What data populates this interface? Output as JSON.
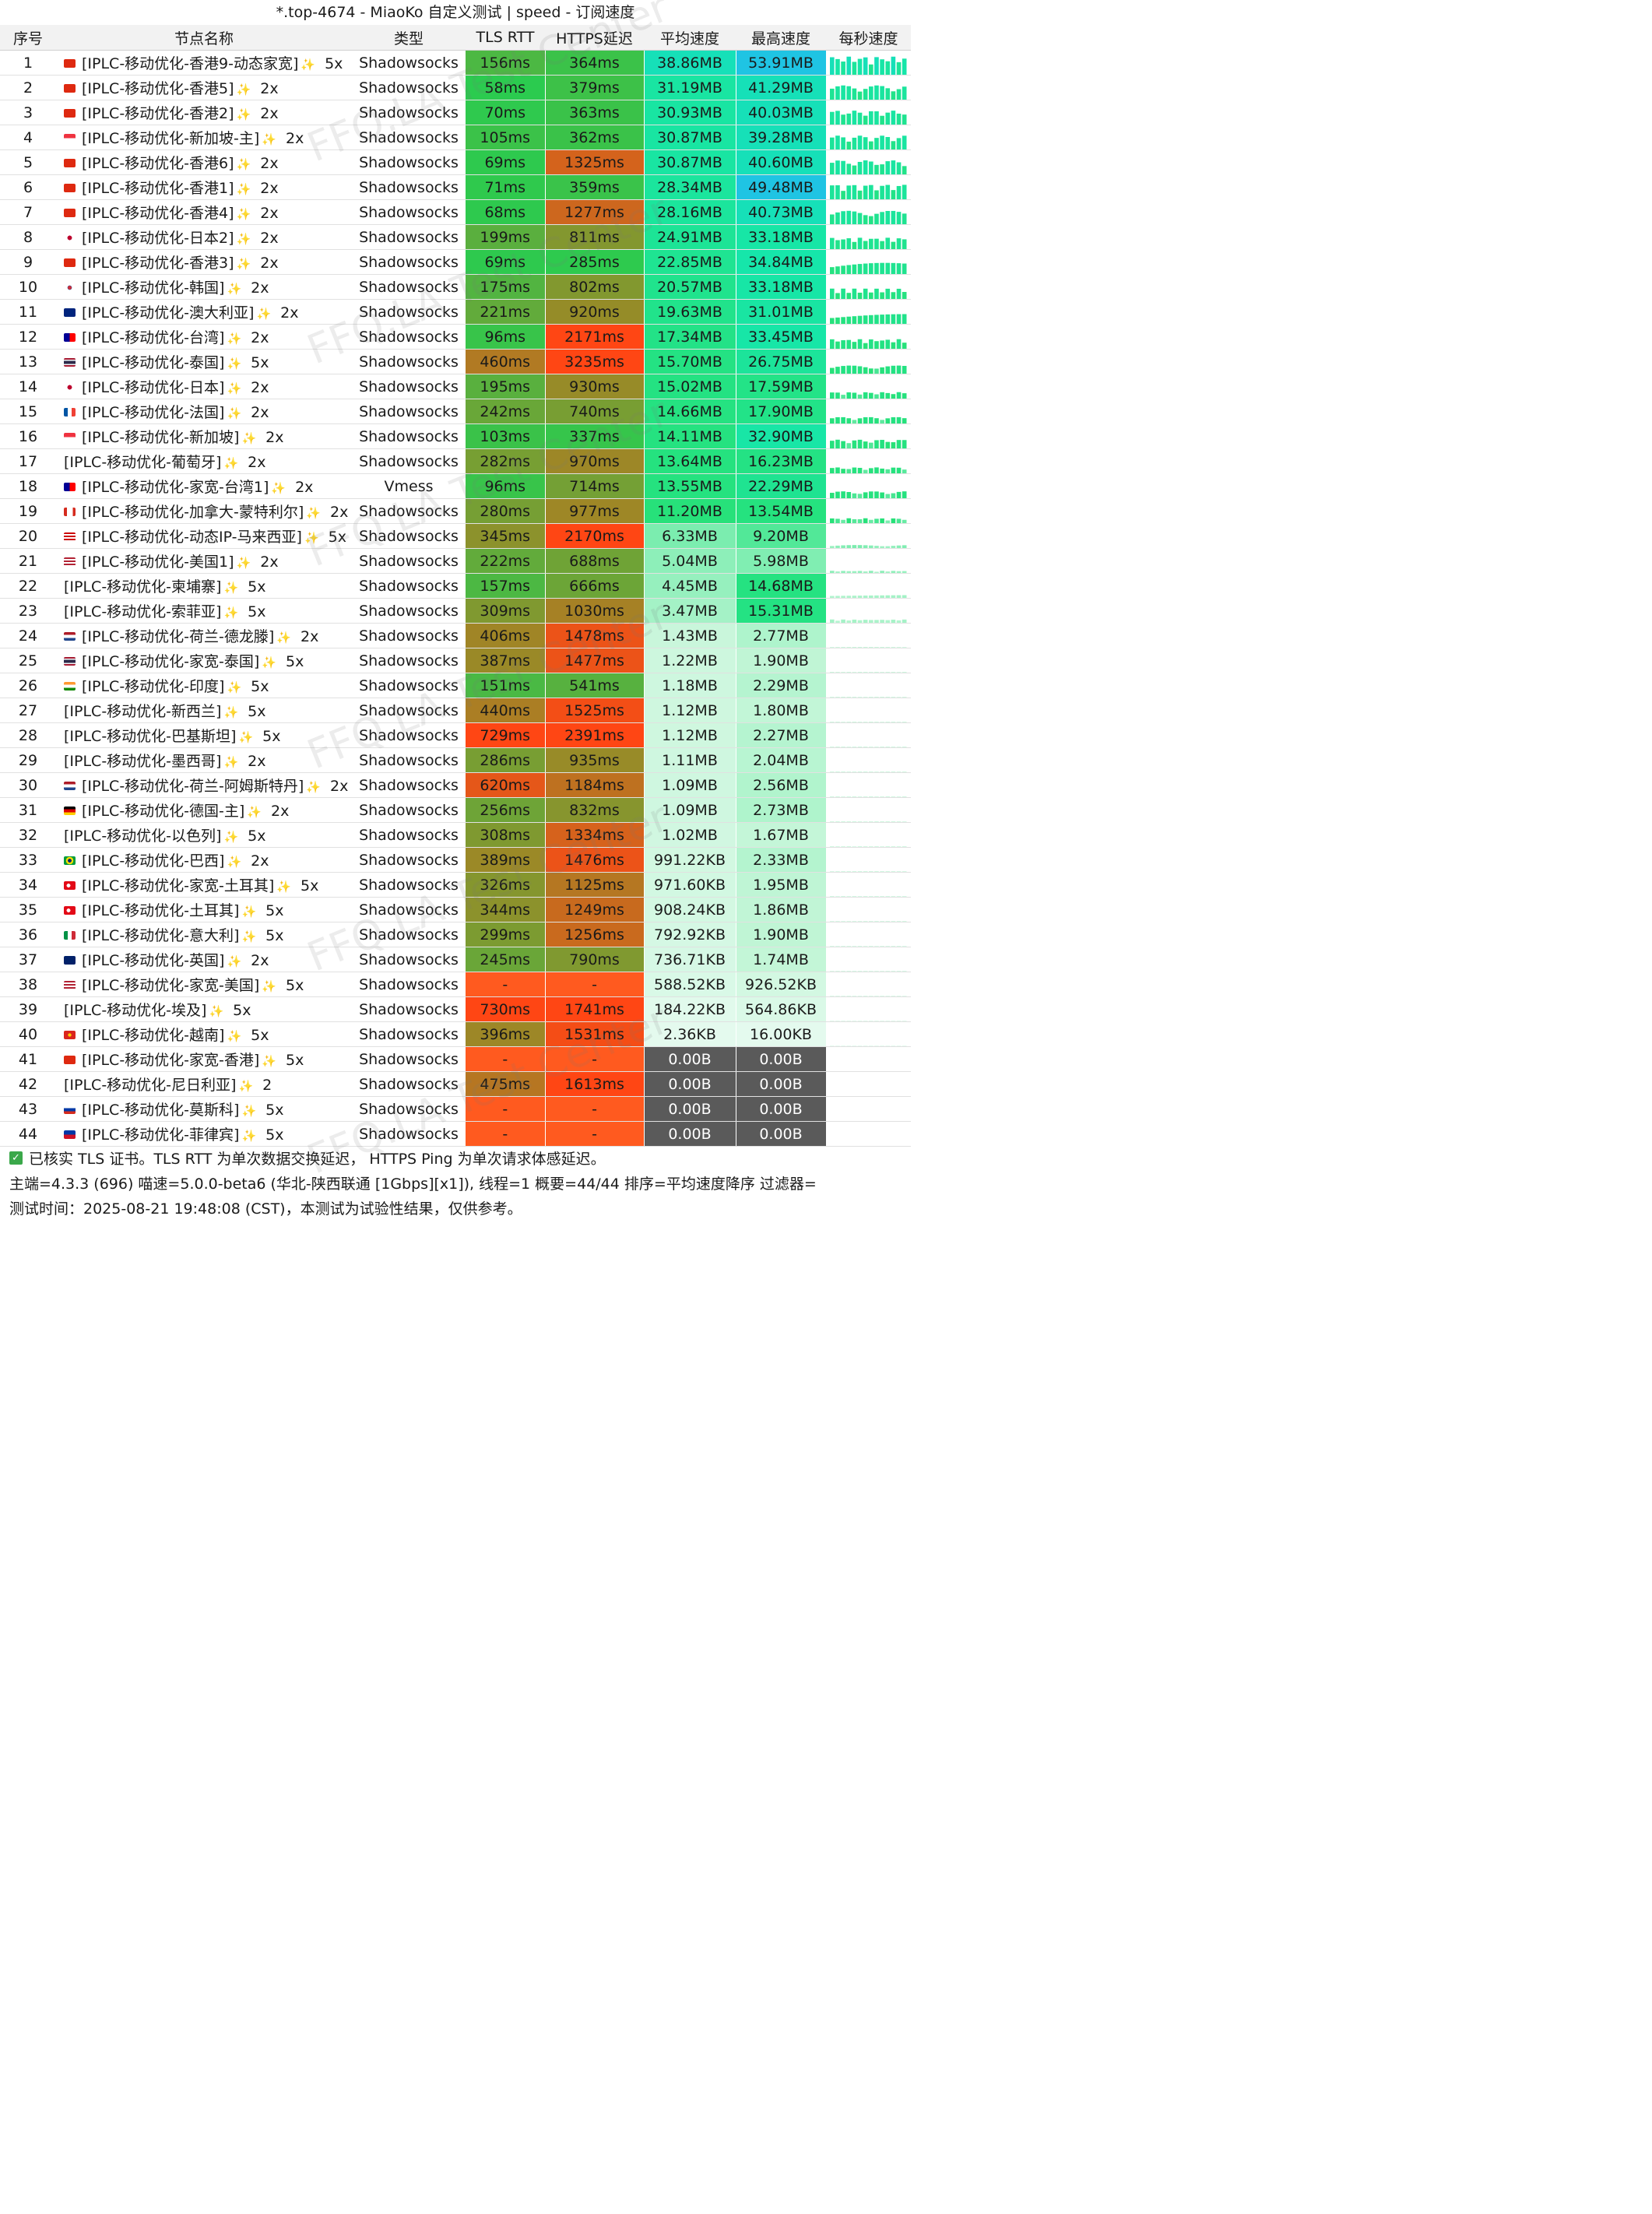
{
  "title": "*.top-4674 - MiaoKo 自定义测试 | speed - 订阅速度",
  "columns": [
    "序号",
    "节点名称",
    "类型",
    "TLS RTT",
    "HTTPS延迟",
    "平均速度",
    "最高速度",
    "每秒速度"
  ],
  "rows": [
    {
      "idx": "1",
      "flag": "hk",
      "name": "[IPLC-移动优化-香港9-动态家宽]",
      "mult": "5x",
      "type": "Shadowsocks",
      "tls": "156ms",
      "https": "364ms",
      "avg": "38.86MB",
      "max": "53.91MB"
    },
    {
      "idx": "2",
      "flag": "hk",
      "name": "[IPLC-移动优化-香港5]",
      "mult": "2x",
      "type": "Shadowsocks",
      "tls": "58ms",
      "https": "379ms",
      "avg": "31.19MB",
      "max": "41.29MB"
    },
    {
      "idx": "3",
      "flag": "hk",
      "name": "[IPLC-移动优化-香港2]",
      "mult": "2x",
      "type": "Shadowsocks",
      "tls": "70ms",
      "https": "363ms",
      "avg": "30.93MB",
      "max": "40.03MB"
    },
    {
      "idx": "4",
      "flag": "sg",
      "name": "[IPLC-移动优化-新加坡-主]",
      "mult": "2x",
      "type": "Shadowsocks",
      "tls": "105ms",
      "https": "362ms",
      "avg": "30.87MB",
      "max": "39.28MB"
    },
    {
      "idx": "5",
      "flag": "hk",
      "name": "[IPLC-移动优化-香港6]",
      "mult": "2x",
      "type": "Shadowsocks",
      "tls": "69ms",
      "https": "1325ms",
      "avg": "30.87MB",
      "max": "40.60MB"
    },
    {
      "idx": "6",
      "flag": "hk",
      "name": "[IPLC-移动优化-香港1]",
      "mult": "2x",
      "type": "Shadowsocks",
      "tls": "71ms",
      "https": "359ms",
      "avg": "28.34MB",
      "max": "49.48MB"
    },
    {
      "idx": "7",
      "flag": "hk",
      "name": "[IPLC-移动优化-香港4]",
      "mult": "2x",
      "type": "Shadowsocks",
      "tls": "68ms",
      "https": "1277ms",
      "avg": "28.16MB",
      "max": "40.73MB"
    },
    {
      "idx": "8",
      "flag": "jp",
      "name": "[IPLC-移动优化-日本2]",
      "mult": "2x",
      "type": "Shadowsocks",
      "tls": "199ms",
      "https": "811ms",
      "avg": "24.91MB",
      "max": "33.18MB"
    },
    {
      "idx": "9",
      "flag": "hk",
      "name": "[IPLC-移动优化-香港3]",
      "mult": "2x",
      "type": "Shadowsocks",
      "tls": "69ms",
      "https": "285ms",
      "avg": "22.85MB",
      "max": "34.84MB"
    },
    {
      "idx": "10",
      "flag": "kr",
      "name": "[IPLC-移动优化-韩国]",
      "mult": "2x",
      "type": "Shadowsocks",
      "tls": "175ms",
      "https": "802ms",
      "avg": "20.57MB",
      "max": "33.18MB"
    },
    {
      "idx": "11",
      "flag": "au",
      "name": "[IPLC-移动优化-澳大利亚]",
      "mult": "2x",
      "type": "Shadowsocks",
      "tls": "221ms",
      "https": "920ms",
      "avg": "19.63MB",
      "max": "31.01MB"
    },
    {
      "idx": "12",
      "flag": "tw",
      "name": "[IPLC-移动优化-台湾]",
      "mult": "2x",
      "type": "Shadowsocks",
      "tls": "96ms",
      "https": "2171ms",
      "avg": "17.34MB",
      "max": "33.45MB"
    },
    {
      "idx": "13",
      "flag": "th",
      "name": "[IPLC-移动优化-泰国]",
      "mult": "5x",
      "type": "Shadowsocks",
      "tls": "460ms",
      "https": "3235ms",
      "avg": "15.70MB",
      "max": "26.75MB"
    },
    {
      "idx": "14",
      "flag": "jp",
      "name": "[IPLC-移动优化-日本]",
      "mult": "2x",
      "type": "Shadowsocks",
      "tls": "195ms",
      "https": "930ms",
      "avg": "15.02MB",
      "max": "17.59MB"
    },
    {
      "idx": "15",
      "flag": "fr",
      "name": "[IPLC-移动优化-法国]",
      "mult": "2x",
      "type": "Shadowsocks",
      "tls": "242ms",
      "https": "740ms",
      "avg": "14.66MB",
      "max": "17.90MB"
    },
    {
      "idx": "16",
      "flag": "sg",
      "name": "[IPLC-移动优化-新加坡]",
      "mult": "2x",
      "type": "Shadowsocks",
      "tls": "103ms",
      "https": "337ms",
      "avg": "14.11MB",
      "max": "32.90MB"
    },
    {
      "idx": "17",
      "flag": "",
      "name": "[IPLC-移动优化-葡萄牙]",
      "mult": "2x",
      "type": "Shadowsocks",
      "tls": "282ms",
      "https": "970ms",
      "avg": "13.64MB",
      "max": "16.23MB"
    },
    {
      "idx": "18",
      "flag": "tw",
      "name": "[IPLC-移动优化-家宽-台湾1]",
      "mult": "2x",
      "type": "Vmess",
      "tls": "96ms",
      "https": "714ms",
      "avg": "13.55MB",
      "max": "22.29MB"
    },
    {
      "idx": "19",
      "flag": "ca",
      "name": "[IPLC-移动优化-加拿大-蒙特利尔]",
      "mult": "2x",
      "type": "Shadowsocks",
      "tls": "280ms",
      "https": "977ms",
      "avg": "11.20MB",
      "max": "13.54MB"
    },
    {
      "idx": "20",
      "flag": "my",
      "name": "[IPLC-移动优化-动态IP-马来西亚]",
      "mult": "5x",
      "type": "Shadowsocks",
      "tls": "345ms",
      "https": "2170ms",
      "avg": "6.33MB",
      "max": "9.20MB"
    },
    {
      "idx": "21",
      "flag": "us",
      "name": "[IPLC-移动优化-美国1]",
      "mult": "2x",
      "type": "Shadowsocks",
      "tls": "222ms",
      "https": "688ms",
      "avg": "5.04MB",
      "max": "5.98MB"
    },
    {
      "idx": "22",
      "flag": "",
      "name": "[IPLC-移动优化-柬埔寨]",
      "mult": "5x",
      "type": "Shadowsocks",
      "tls": "157ms",
      "https": "666ms",
      "avg": "4.45MB",
      "max": "14.68MB"
    },
    {
      "idx": "23",
      "flag": "",
      "name": "[IPLC-移动优化-索菲亚]",
      "mult": "5x",
      "type": "Shadowsocks",
      "tls": "309ms",
      "https": "1030ms",
      "avg": "3.47MB",
      "max": "15.31MB"
    },
    {
      "idx": "24",
      "flag": "nl",
      "name": "[IPLC-移动优化-荷兰-德龙滕]",
      "mult": "2x",
      "type": "Shadowsocks",
      "tls": "406ms",
      "https": "1478ms",
      "avg": "1.43MB",
      "max": "2.77MB"
    },
    {
      "idx": "25",
      "flag": "th",
      "name": "[IPLC-移动优化-家宽-泰国]",
      "mult": "5x",
      "type": "Shadowsocks",
      "tls": "387ms",
      "https": "1477ms",
      "avg": "1.22MB",
      "max": "1.90MB"
    },
    {
      "idx": "26",
      "flag": "in",
      "name": "[IPLC-移动优化-印度]",
      "mult": "5x",
      "type": "Shadowsocks",
      "tls": "151ms",
      "https": "541ms",
      "avg": "1.18MB",
      "max": "2.29MB"
    },
    {
      "idx": "27",
      "flag": "",
      "name": "[IPLC-移动优化-新西兰]",
      "mult": "5x",
      "type": "Shadowsocks",
      "tls": "440ms",
      "https": "1525ms",
      "avg": "1.12MB",
      "max": "1.80MB"
    },
    {
      "idx": "28",
      "flag": "",
      "name": "[IPLC-移动优化-巴基斯坦]",
      "mult": "5x",
      "type": "Shadowsocks",
      "tls": "729ms",
      "https": "2391ms",
      "avg": "1.12MB",
      "max": "2.27MB"
    },
    {
      "idx": "29",
      "flag": "",
      "name": "[IPLC-移动优化-墨西哥]",
      "mult": "2x",
      "type": "Shadowsocks",
      "tls": "286ms",
      "https": "935ms",
      "avg": "1.11MB",
      "max": "2.04MB"
    },
    {
      "idx": "30",
      "flag": "nl",
      "name": "[IPLC-移动优化-荷兰-阿姆斯特丹]",
      "mult": "2x",
      "type": "Shadowsocks",
      "tls": "620ms",
      "https": "1184ms",
      "avg": "1.09MB",
      "max": "2.56MB"
    },
    {
      "idx": "31",
      "flag": "de",
      "name": "[IPLC-移动优化-德国-主]",
      "mult": "2x",
      "type": "Shadowsocks",
      "tls": "256ms",
      "https": "832ms",
      "avg": "1.09MB",
      "max": "2.73MB"
    },
    {
      "idx": "32",
      "flag": "",
      "name": "[IPLC-移动优化-以色列]",
      "mult": "5x",
      "type": "Shadowsocks",
      "tls": "308ms",
      "https": "1334ms",
      "avg": "1.02MB",
      "max": "1.67MB"
    },
    {
      "idx": "33",
      "flag": "br",
      "name": "[IPLC-移动优化-巴西]",
      "mult": "2x",
      "type": "Shadowsocks",
      "tls": "389ms",
      "https": "1476ms",
      "avg": "991.22KB",
      "max": "2.33MB"
    },
    {
      "idx": "34",
      "flag": "tr",
      "name": "[IPLC-移动优化-家宽-土耳其]",
      "mult": "5x",
      "type": "Shadowsocks",
      "tls": "326ms",
      "https": "1125ms",
      "avg": "971.60KB",
      "max": "1.95MB"
    },
    {
      "idx": "35",
      "flag": "tr",
      "name": "[IPLC-移动优化-土耳其]",
      "mult": "5x",
      "type": "Shadowsocks",
      "tls": "344ms",
      "https": "1249ms",
      "avg": "908.24KB",
      "max": "1.86MB"
    },
    {
      "idx": "36",
      "flag": "it",
      "name": "[IPLC-移动优化-意大利]",
      "mult": "5x",
      "type": "Shadowsocks",
      "tls": "299ms",
      "https": "1256ms",
      "avg": "792.92KB",
      "max": "1.90MB"
    },
    {
      "idx": "37",
      "flag": "gb",
      "name": "[IPLC-移动优化-英国]",
      "mult": "2x",
      "type": "Shadowsocks",
      "tls": "245ms",
      "https": "790ms",
      "avg": "736.71KB",
      "max": "1.74MB"
    },
    {
      "idx": "38",
      "flag": "us",
      "name": "[IPLC-移动优化-家宽-美国]",
      "mult": "5x",
      "type": "Shadowsocks",
      "tls": "-",
      "https": "-",
      "avg": "588.52KB",
      "max": "926.52KB"
    },
    {
      "idx": "39",
      "flag": "",
      "name": "[IPLC-移动优化-埃及]",
      "mult": "5x",
      "type": "Shadowsocks",
      "tls": "730ms",
      "https": "1741ms",
      "avg": "184.22KB",
      "max": "564.86KB"
    },
    {
      "idx": "40",
      "flag": "vn",
      "name": "[IPLC-移动优化-越南]",
      "mult": "5x",
      "type": "Shadowsocks",
      "tls": "396ms",
      "https": "1531ms",
      "avg": "2.36KB",
      "max": "16.00KB"
    },
    {
      "idx": "41",
      "flag": "hk",
      "name": "[IPLC-移动优化-家宽-香港]",
      "mult": "5x",
      "type": "Shadowsocks",
      "tls": "-",
      "https": "-",
      "avg": "0.00B",
      "max": "0.00B"
    },
    {
      "idx": "42",
      "flag": "",
      "name": "[IPLC-移动优化-尼日利亚]",
      "mult": "2",
      "type": "Shadowsocks",
      "tls": "475ms",
      "https": "1613ms",
      "avg": "0.00B",
      "max": "0.00B"
    },
    {
      "idx": "43",
      "flag": "ru",
      "name": "[IPLC-移动优化-莫斯科]",
      "mult": "5x",
      "type": "Shadowsocks",
      "tls": "-",
      "https": "-",
      "avg": "0.00B",
      "max": "0.00B"
    },
    {
      "idx": "44",
      "flag": "ph",
      "name": "[IPLC-移动优化-菲律宾]",
      "mult": "5x",
      "type": "Shadowsocks",
      "tls": "-",
      "https": "-",
      "avg": "0.00B",
      "max": "0.00B"
    }
  ],
  "footer": {
    "line1": "已核实 TLS 证书。TLS RTT 为单次数据交换延迟， HTTPS Ping 为单次请求体感延迟。",
    "line2": "主端=4.3.3 (696) 喵速=5.0.0-beta6 (华北-陕西联通 [1Gbps][x1]), 线程=1 概要=44/44 排序=平均速度降序 过滤器=",
    "line3": "测试时间：2025-08-21 19:48:08 (CST)，本测试为试验性结果，仅供参考。"
  },
  "watermark": "FFQ.LA Test Center",
  "colors": {
    "missing": "#ff5a1f",
    "zero_speed": "#5a5a5a",
    "star": "#f2b51d",
    "check": "#3aa84a"
  }
}
